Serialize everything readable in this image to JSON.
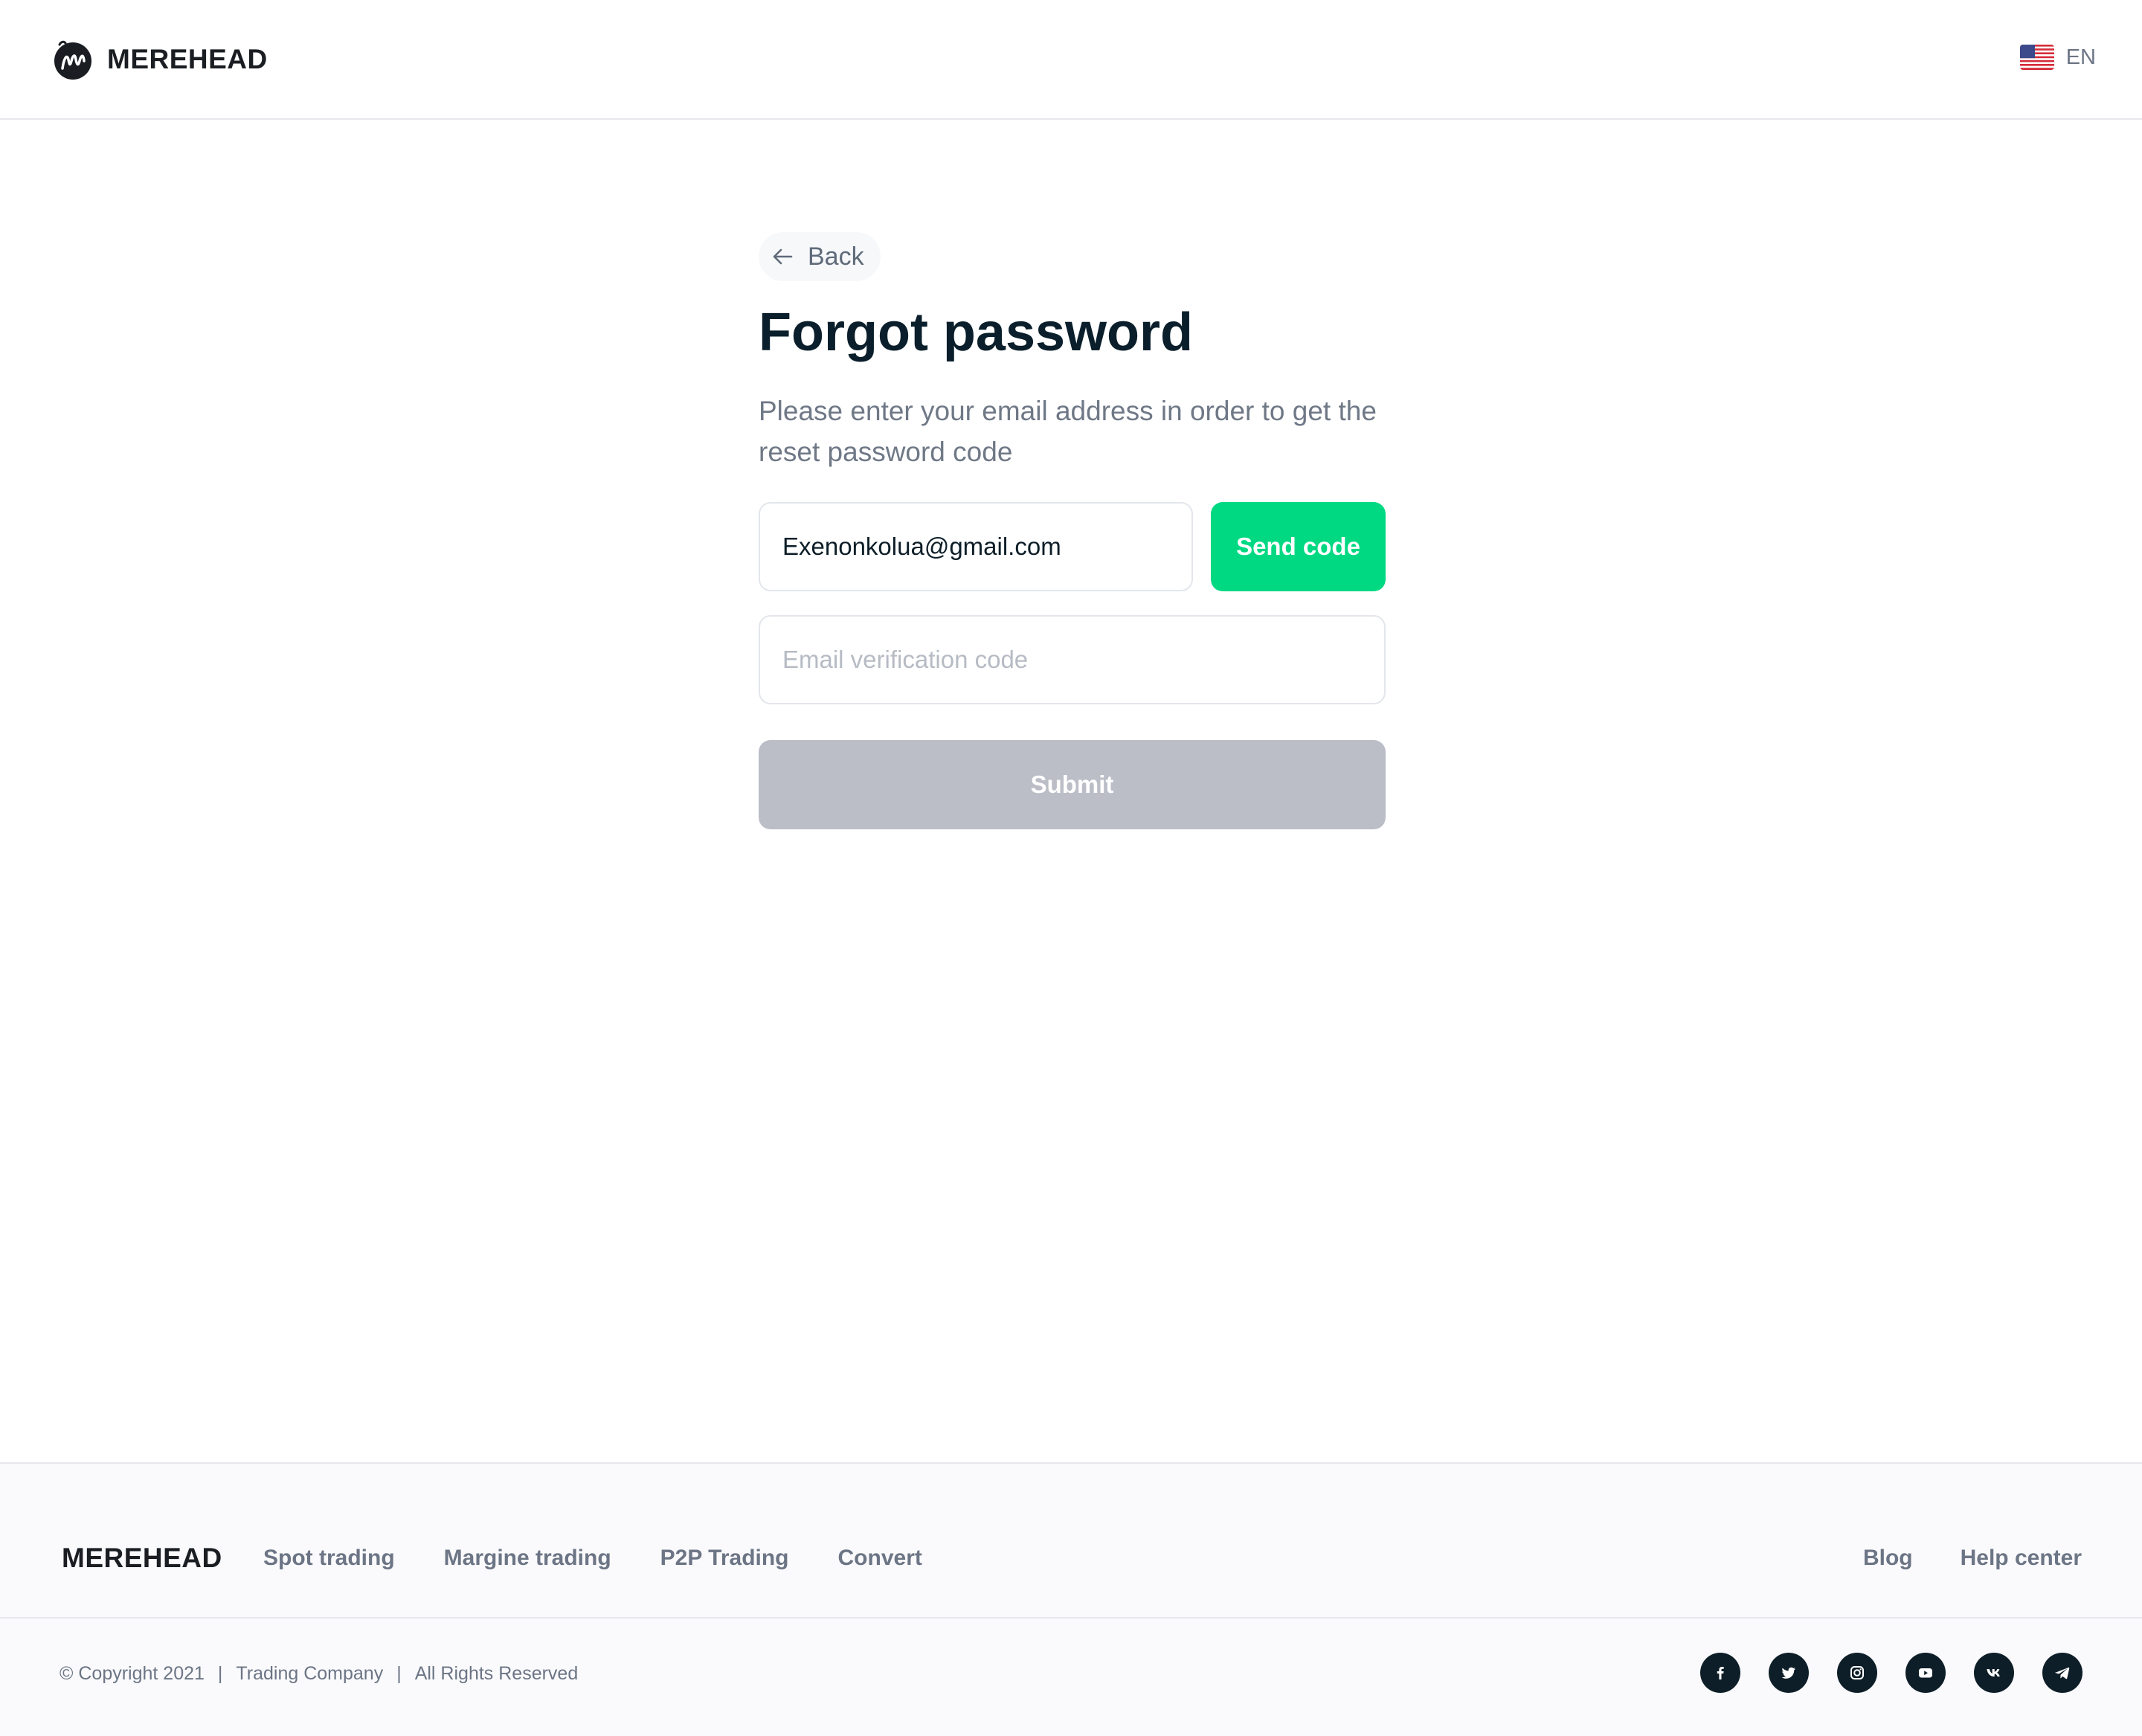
{
  "header": {
    "brand": "MEREHEAD",
    "language": "EN",
    "flag_icon": "us-flag-icon"
  },
  "form": {
    "back_label": "Back",
    "title": "Forgot password",
    "subtitle": "Please enter your email address in order to get the reset password code",
    "email_value": "Exenonkolua@gmail.com",
    "send_code_label": "Send code",
    "code_placeholder": "Email verification code",
    "submit_label": "Submit"
  },
  "colors": {
    "accent_green": "#00d882",
    "disabled_gray": "#bbbec7",
    "dark": "#0d1e28"
  },
  "footer": {
    "brand": "MEREHEAD",
    "nav": [
      "Spot trading",
      "Margine trading",
      "P2P Trading",
      "Convert"
    ],
    "right_links": [
      "Blog",
      "Help center"
    ],
    "copyright": "© Copyright 2021",
    "company": "Trading Company",
    "rights": "All Rights Reserved",
    "socials": [
      "facebook-icon",
      "twitter-icon",
      "instagram-icon",
      "youtube-icon",
      "vk-icon",
      "telegram-icon"
    ]
  }
}
